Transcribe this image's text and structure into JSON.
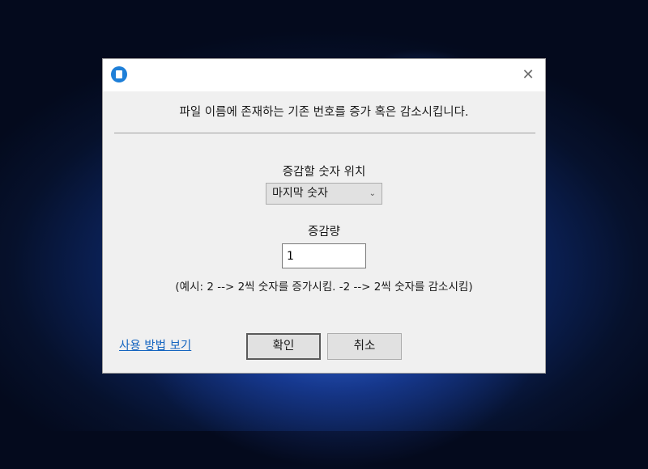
{
  "dialog": {
    "close_glyph": "✕",
    "description": "파일 이름에 존재하는 기존 번호를 증가 혹은 감소시킵니다.",
    "position_label": "증감할 숫자 위치",
    "position_select": {
      "selected": "마지막 숫자",
      "chevron": "⌄"
    },
    "amount_label": "증감량",
    "amount_value": "1",
    "example": "(예시: 2 --> 2씩 숫자를 증가시킴. -2 --> 2씩 숫자를 감소시킴)",
    "help_link": "사용 방법 보기",
    "ok_label": "확인",
    "cancel_label": "취소"
  },
  "icons": {
    "app": "app-icon",
    "close": "close-icon",
    "dropdown": "chevron-down-icon"
  },
  "colors": {
    "accent": "#1e7fd8",
    "link": "#1565c0",
    "dialog_bg": "#f0f0f0"
  }
}
